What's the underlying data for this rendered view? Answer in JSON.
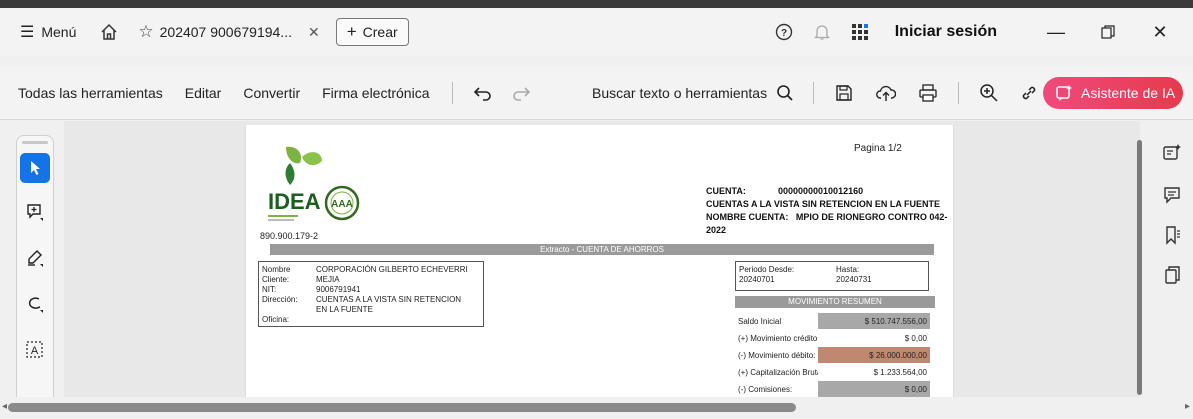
{
  "window": {
    "menu_label": "Menú",
    "tab_title": "202407 900679194...",
    "create_label": "Crear",
    "signin_label": "Iniciar sesión"
  },
  "toolbar": {
    "all_tools": "Todas las herramientas",
    "edit": "Editar",
    "convert": "Convertir",
    "esign": "Firma electrónica",
    "search_label": "Buscar texto o herramientas",
    "ai_assistant": "Asistente de IA",
    "ai_color": "#e8405c"
  },
  "document": {
    "page_indicator": "Pagina   1/2",
    "logo_text": "IDEA",
    "logo_rating": "AAA",
    "logo_nit": "890.900.179-2",
    "account": {
      "cuenta_label": "CUENTA:",
      "cuenta_value": "00000000010012160",
      "tipo": "CUENTAS A LA VISTA SIN RETENCION EN LA FUENTE",
      "nombre_label": "NOMBRE CUENTA:",
      "nombre_value": "MPIO DE RIONEGRO CONTRO 042-2022"
    },
    "band_title": "Extracto - CUENTA DE AHORROS",
    "client": {
      "nombre_label": "Nombre Cliente:",
      "nombre_value": "CORPORACIÓN GILBERTO ECHEVERRI MEJIA",
      "nit_label": "NIT:",
      "nit_value": "9006791941",
      "direccion_label": "Dirección:",
      "direccion_value": "CUENTAS A LA VISTA SIN RETENCION EN LA FUENTE",
      "oficina_label": "Oficina:"
    },
    "period": {
      "desde_label": "Periodo Desde:",
      "desde_value": "20240701",
      "hasta_label": "Hasta:",
      "hasta_value": "20240731"
    },
    "resumen_title": "MOVIMIENTO RESUMEN",
    "resumen": [
      {
        "label": "Saldo Inicial",
        "value": "$ 510.747.556,00",
        "shade": "#a8a8a8"
      },
      {
        "label": "(+) Movimiento crédito:",
        "value": "$ 0,00",
        "shade": "#ffffff"
      },
      {
        "label": "(-) Movimiento débito:",
        "value": "$ 26.000.000,00",
        "shade": "#c08870"
      },
      {
        "label": "(+) Capitalización Bruta:",
        "value": "$ 1.233.564,00",
        "shade": "#ffffff"
      },
      {
        "label": "(-) Comisiones:",
        "value": "$ 0,00",
        "shade": "#a8a8a8"
      }
    ]
  },
  "icons": {
    "home": "home-icon",
    "star": "star-icon",
    "help": "help-icon",
    "bell": "bell-icon",
    "apps": "apps-icon"
  }
}
